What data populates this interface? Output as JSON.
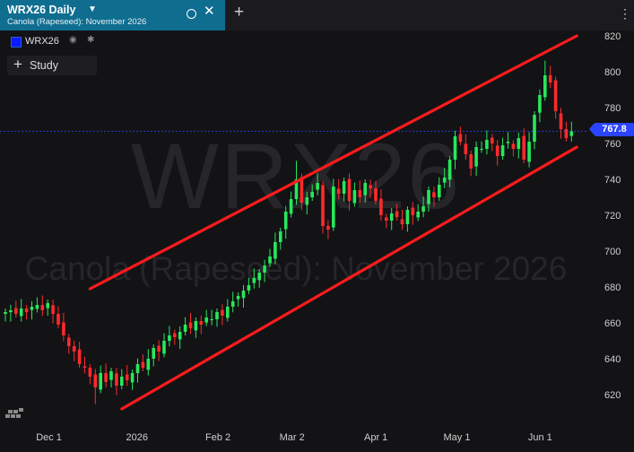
{
  "tab": {
    "title": "WRX26 Daily",
    "subtitle": "Canola (Rapeseed): November 2026",
    "caret_icon": "caret-down-icon",
    "circle_icon": "circle-icon",
    "close_icon": "close-icon",
    "add_icon": "plus-icon"
  },
  "menu": {
    "icon": "kebab-menu-icon",
    "glyph": "⋮"
  },
  "legend": {
    "symbol": "WRX26",
    "color": "#0a1cff",
    "eye_icon": "eye-icon",
    "gear_icon": "gear-icon"
  },
  "study_button": {
    "label": "Study",
    "icon": "plus-icon"
  },
  "watermark": {
    "symbol": "WRX26",
    "description": "Canola (Rapeseed): November 2026"
  },
  "current_price": {
    "label": "767.8",
    "value": 767.8,
    "color": "#2b44ff"
  },
  "chart_data": {
    "type": "candlestick",
    "y_axis": {
      "min": 610,
      "max": 825,
      "ticks": [
        820,
        800,
        780,
        760,
        740,
        720,
        700,
        680,
        660,
        640,
        620
      ],
      "side": "right"
    },
    "x_axis": {
      "labels": [
        "Dec 1",
        "2026",
        "Feb 2",
        "Mar 2",
        "Apr 1",
        "May 1",
        "Jun 1"
      ],
      "label_index": [
        8,
        25,
        40,
        54,
        70,
        85,
        101
      ]
    },
    "colors": {
      "up": "#27e85a",
      "down": "#ff2a2a",
      "trendline": "#ff1b1b",
      "price_line": "#2b44ff"
    },
    "trendlines": [
      {
        "name": "upper-channel",
        "start": {
          "index": 16,
          "price": 680
        },
        "end": {
          "index": 108,
          "price": 821
        }
      },
      {
        "name": "lower-channel",
        "start": {
          "index": 22,
          "price": 613
        },
        "end": {
          "index": 108,
          "price": 759
        }
      }
    ],
    "closes": [
      667,
      668,
      666,
      669,
      667,
      670,
      671,
      668,
      672,
      666,
      660,
      654,
      648,
      645,
      638,
      636,
      631,
      625,
      633,
      628,
      634,
      626,
      631,
      629,
      633,
      638,
      636,
      641,
      647,
      645,
      651,
      654,
      653,
      656,
      660,
      658,
      662,
      660,
      664,
      663,
      667,
      665,
      670,
      673,
      676,
      679,
      682,
      686,
      689,
      693,
      698,
      706,
      712,
      723,
      730,
      741,
      728,
      731,
      734,
      739,
      715,
      713,
      737,
      733,
      740,
      729,
      735,
      731,
      739,
      736,
      729,
      721,
      718,
      722,
      720,
      716,
      724,
      721,
      723,
      726,
      735,
      731,
      738,
      742,
      752,
      765,
      762,
      755,
      747,
      759,
      758,
      763,
      761,
      754,
      760,
      762,
      758,
      764,
      752,
      762,
      777,
      788,
      799,
      795,
      779,
      769,
      764,
      767.8
    ]
  }
}
